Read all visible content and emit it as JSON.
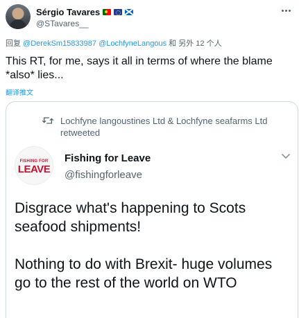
{
  "tweet": {
    "author": {
      "display_name": "Sérgio Tavares",
      "flags": [
        "portugal-flag-icon",
        "eu-flag-icon",
        "scotland-flag-icon"
      ],
      "handle": "@STavares__"
    },
    "reply_prefix": "回复",
    "reply_to": [
      "@DerekSm15833987",
      "@LochfyneLangous"
    ],
    "reply_suffix": "和 另外 12 个人",
    "text": "This RT, for me, says it all in terms of where the blame *also* lies...",
    "translate_label": "翻译推文"
  },
  "quoted": {
    "retweet_context": "Lochfyne langoustines Ltd & Lochfyne seafarms Ltd retweeted",
    "author": {
      "logo_top": "FISHING FOR",
      "logo_main": "LEAVE",
      "display_name": "Fishing for Leave",
      "handle": "@fishingforleave"
    },
    "paragraphs": [
      "Disgrace what's happening to Scots seafood shipments!",
      "Nothing to do with Brexit- huge volumes go to the rest of the world on WTO"
    ]
  },
  "colors": {
    "accent": "#1d9bf0",
    "text_primary": "#0f1419",
    "text_secondary": "#536471",
    "border": "#cfd9de",
    "logo_red": "#c8102e"
  }
}
